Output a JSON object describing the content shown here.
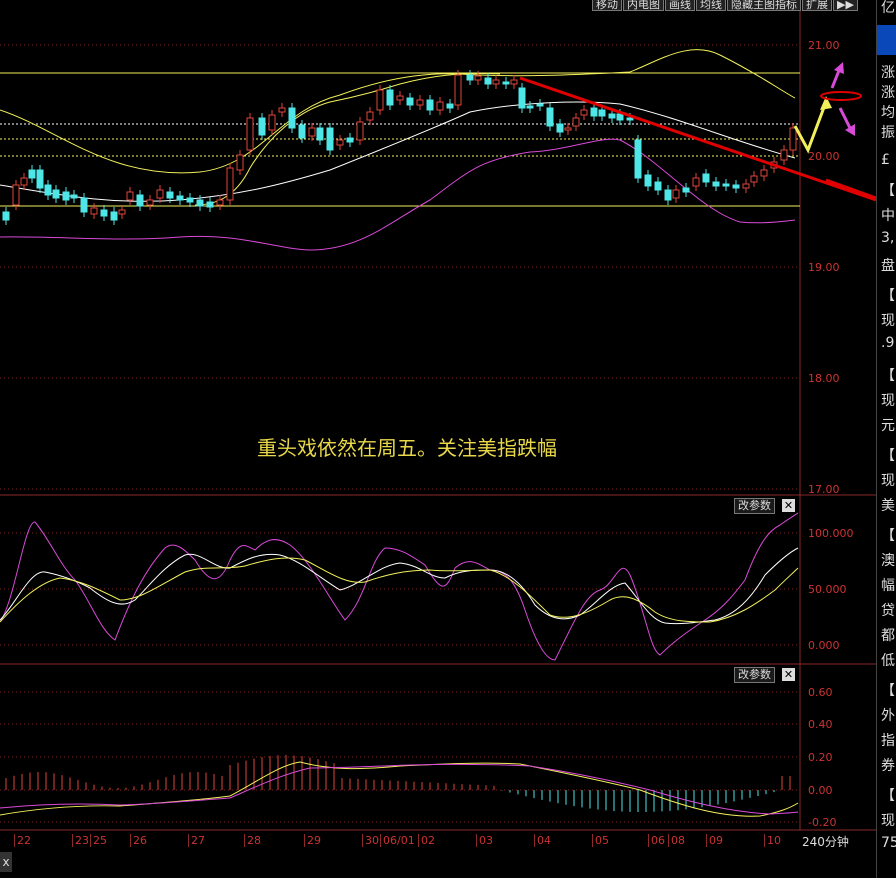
{
  "toolbar": {
    "items": [
      "移动",
      "内电图",
      "画线",
      "均线",
      "隐藏主图指标",
      "扩展",
      "▶▶"
    ]
  },
  "price_axis": {
    "labels": [
      "21.00",
      "20.00",
      "19.00",
      "18.00",
      "17.00"
    ]
  },
  "annotation": "重头戏依然在周五。关注美指跌幅",
  "kdj_panel": {
    "param_label": "改参数",
    "close_label": "✕",
    "axis_labels": [
      "100.000",
      "50.000",
      "0.000"
    ]
  },
  "macd_panel": {
    "param_label": "改参数",
    "close_label": "✕",
    "axis_labels": [
      "0.60",
      "0.40",
      "0.20",
      "0.00",
      "-0.20"
    ]
  },
  "x_axis": {
    "labels": [
      "22",
      "23",
      "25",
      "26",
      "27",
      "28",
      "29",
      "30",
      "06/01",
      "02",
      "03",
      "04",
      "05",
      "06",
      "08",
      "09",
      "10"
    ],
    "period": "240分钟"
  },
  "sidebar": {
    "header": "亿",
    "items": [
      "涨",
      "涨",
      "均",
      "振",
      "£",
      "【",
      "中",
      "3,",
      "盘",
      "【",
      "现",
      ".9",
      "【",
      "现",
      "元",
      "【",
      "现",
      "美",
      "【",
      "澳",
      "幅",
      "贷",
      "都",
      "低",
      "【",
      "外",
      "指",
      "券",
      "【",
      "现",
      "75"
    ]
  },
  "bottom_left": "x",
  "colors": {
    "up": "#e0443a",
    "down": "#4ee6e6",
    "ma_white": "#ffffff",
    "ma_yellow": "#f2f05a",
    "boll": "#d94ad9",
    "grid": "#8a2a2a",
    "trend": "#e00000",
    "annotation": "#e8d84a"
  }
}
